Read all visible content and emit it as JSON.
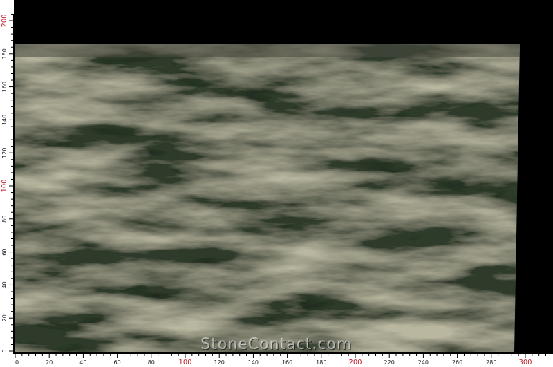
{
  "image": {
    "subject": "marble-slab",
    "colors": {
      "background": "#000000",
      "slab_base": "#2f3a2c",
      "slab_light": "#b9b7a0",
      "slab_dark": "#101812",
      "ruler_tick": "#000000",
      "ruler_label_major": "#c0202a",
      "ruler_label_minor": "#222222"
    }
  },
  "watermark": {
    "text": "StoneContact.com"
  },
  "ruler_vertical": {
    "labels": [
      "0",
      "20",
      "40",
      "60",
      "80",
      "100",
      "120",
      "140",
      "160",
      "180",
      "200"
    ],
    "major": [
      "100",
      "200"
    ]
  },
  "ruler_horizontal": {
    "labels": [
      "0",
      "20",
      "40",
      "60",
      "80",
      "100",
      "120",
      "140",
      "160",
      "180",
      "200",
      "220",
      "240",
      "260",
      "280",
      "300"
    ],
    "major": [
      "100",
      "200",
      "300"
    ]
  }
}
